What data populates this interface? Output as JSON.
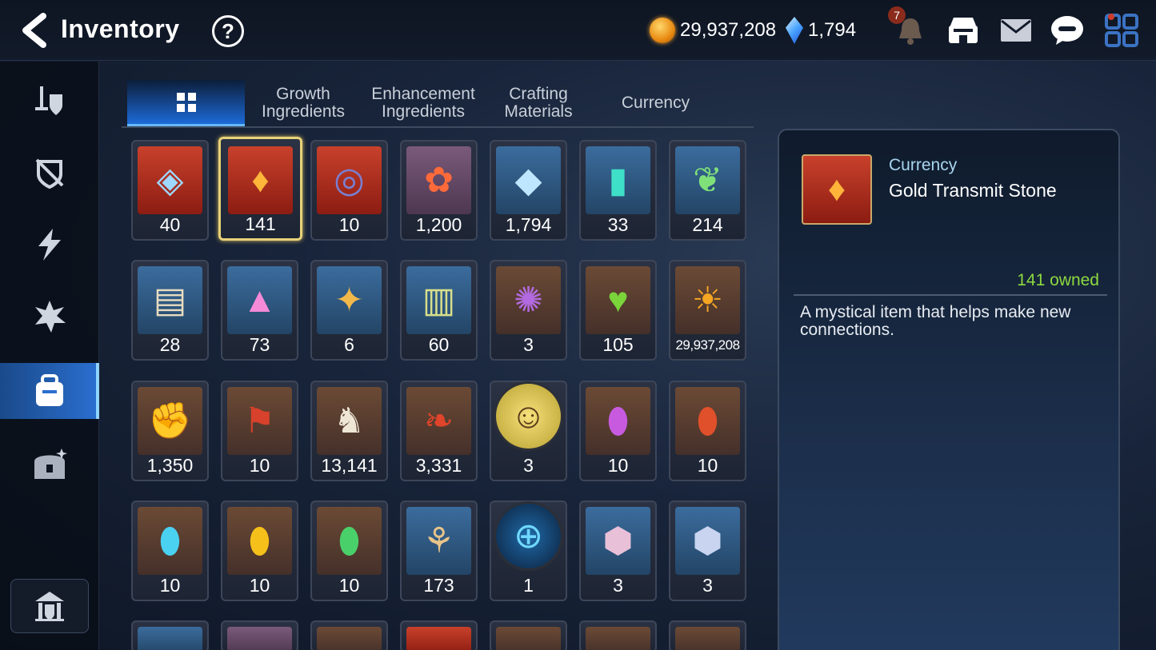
{
  "header": {
    "title": "Inventory",
    "back_icon": "back-arrow-icon",
    "help_label": "?",
    "gold": "29,937,208",
    "gems": "1,794",
    "notifications": "7"
  },
  "tabs": [
    {
      "label": "",
      "icon": "grid-icon",
      "active": true
    },
    {
      "label": "Growth\nIngredients"
    },
    {
      "label": "Enhancement\nIngredients"
    },
    {
      "label": "Crafting\nMaterials"
    },
    {
      "label": "Currency"
    }
  ],
  "sidebar": {
    "items": [
      {
        "icon": "equipment-icon"
      },
      {
        "icon": "artifact-icon"
      },
      {
        "icon": "lightning-icon"
      },
      {
        "icon": "catalyst-icon"
      },
      {
        "icon": "inventory-bag-icon",
        "active": true
      },
      {
        "icon": "chest-icon"
      }
    ],
    "bottom_icon": "sanctuary-icon"
  },
  "items": [
    [
      "40",
      "141",
      "10",
      "1,200",
      "1,794",
      "33",
      "214"
    ],
    [
      "28",
      "73",
      "6",
      "60",
      "3",
      "105",
      "29,937,208"
    ],
    [
      "1,350",
      "10",
      "13,141",
      "3,331",
      "3",
      "10",
      "10"
    ],
    [
      "10",
      "10",
      "10",
      "173",
      "1",
      "3",
      "3"
    ]
  ],
  "detail": {
    "category": "Currency",
    "name": "Gold Transmit Stone",
    "owned": "141 owned",
    "description": "A mystical item that helps make new connections."
  },
  "colors": {
    "accent_blue": "#2a6fd0",
    "owned_green": "#8dd93f",
    "selected_gold": "#e7d27a",
    "category_text": "#a8d5ee"
  }
}
